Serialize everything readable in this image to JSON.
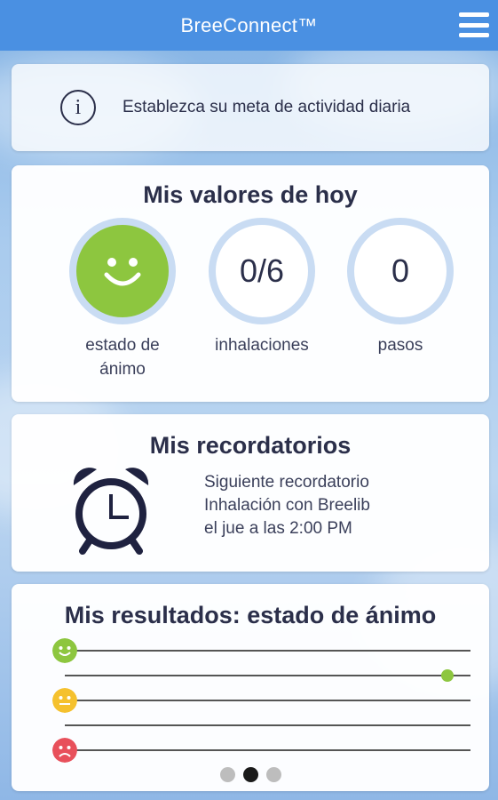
{
  "header": {
    "title": "BreeConnect™",
    "menu_icon": "hamburger-menu-icon"
  },
  "info": {
    "icon": "info-icon",
    "text": "Establezca su meta de actividad diaria"
  },
  "today": {
    "title": "Mis valores de hoy",
    "metrics": [
      {
        "id": "mood",
        "value": "",
        "icon": "smiley-face-icon",
        "label_line1": "estado de",
        "label_line2": "ánimo",
        "color": "#8dc63f"
      },
      {
        "id": "inhalations",
        "value": "0/6",
        "label_line1": "inhalaciones",
        "label_line2": ""
      },
      {
        "id": "steps",
        "value": "0",
        "label_line1": "pasos",
        "label_line2": ""
      }
    ]
  },
  "reminders": {
    "title": "Mis recordatorios",
    "icon": "alarm-clock-icon",
    "line1": "Siguiente recordatorio",
    "line2": "Inhalación con Breelib",
    "line3": "el jue a las 2:00 PM"
  },
  "results": {
    "title": "Mis resultados: estado de ánimo",
    "levels": [
      {
        "name": "happy",
        "icon": "happy-face-icon",
        "color": "#8dc63f"
      },
      {
        "name": "neutral",
        "icon": "neutral-face-icon",
        "color": "#f5c12e"
      },
      {
        "name": "sad",
        "icon": "sad-face-icon",
        "color": "#e8505b"
      }
    ],
    "marker_color": "#8dc63f",
    "pager": {
      "pages": 3,
      "active": 2
    }
  }
}
